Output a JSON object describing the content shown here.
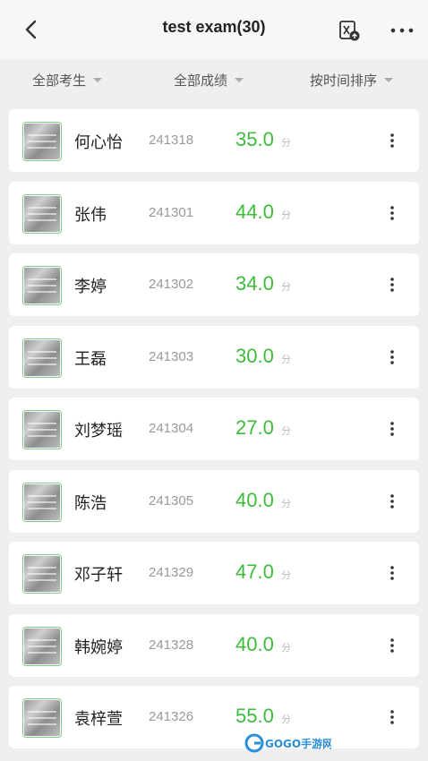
{
  "header": {
    "title": "test exam(30)",
    "back_icon": "chevron-left-icon",
    "export_icon": "export-document-icon",
    "more_icon": "more-horizontal-icon"
  },
  "filters": [
    {
      "label": "全部考生"
    },
    {
      "label": "全部成绩"
    },
    {
      "label": "按时间排序"
    }
  ],
  "students": [
    {
      "name": "何心怡",
      "id": "241318",
      "score": "35.0",
      "unit": "分"
    },
    {
      "name": "张伟",
      "id": "241301",
      "score": "44.0",
      "unit": "分"
    },
    {
      "name": "李婷",
      "id": "241302",
      "score": "34.0",
      "unit": "分"
    },
    {
      "name": "王磊",
      "id": "241303",
      "score": "30.0",
      "unit": "分"
    },
    {
      "name": "刘梦瑶",
      "id": "241304",
      "score": "27.0",
      "unit": "分"
    },
    {
      "name": "陈浩",
      "id": "241305",
      "score": "40.0",
      "unit": "分"
    },
    {
      "name": "邓子轩",
      "id": "241329",
      "score": "47.0",
      "unit": "分"
    },
    {
      "name": "韩婉婷",
      "id": "241328",
      "score": "40.0",
      "unit": "分"
    },
    {
      "name": "袁梓萱",
      "id": "241326",
      "score": "55.0",
      "unit": "分"
    }
  ],
  "colors": {
    "score": "#3dbb3a",
    "thumb_border": "#7fcf84",
    "background": "#efeff1"
  },
  "watermark": {
    "text": "GOGO手游网"
  }
}
